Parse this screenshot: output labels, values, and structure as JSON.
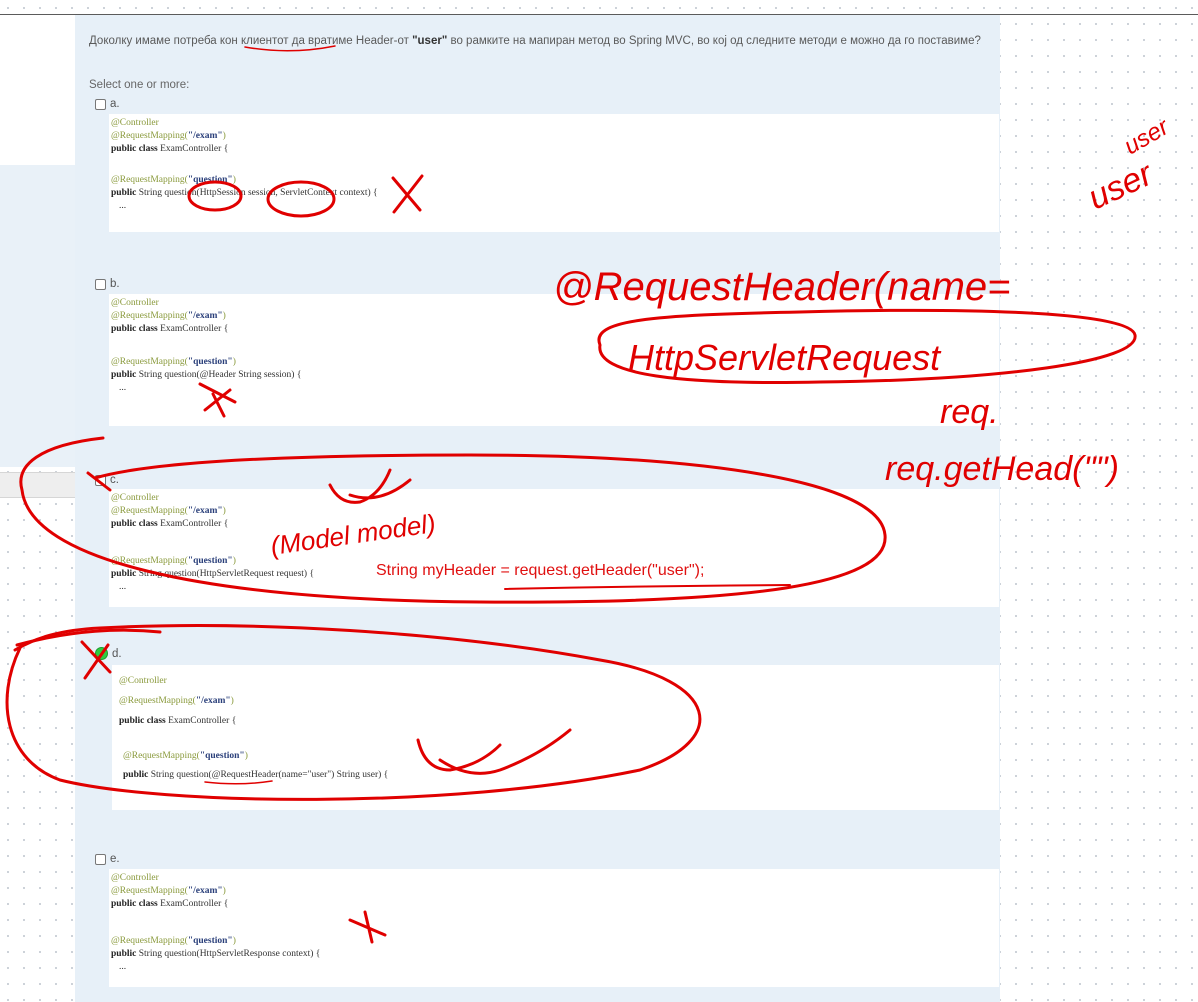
{
  "question": {
    "text_before": "Доколку имаме потреба кон клиентот да вратиме ",
    "header_word": "Header-от",
    "user_quoted": "\"user\"",
    "text_after": " во рамките на мапиран метод во Spring MVC, во кој од следните методи е можно да го поставиме?",
    "select_label": "Select one or more:"
  },
  "options": [
    {
      "letter": "a.",
      "checked": false,
      "lines": {
        "l1": "@Controller",
        "l2a": "@RequestMapping(",
        "l2b": "\"/exam\"",
        "l2c": ")",
        "l3a": "public class",
        "l3b": " ExamController {",
        "l4a": "@RequestMapping(",
        "l4b": "\"question\"",
        "l4c": ")",
        "l5a": "public",
        "l5b": " String question(HttpSession session, ServletContext context) {",
        "l6": "..."
      }
    },
    {
      "letter": "b.",
      "checked": false,
      "lines": {
        "l1": "@Controller",
        "l2a": "@RequestMapping(",
        "l2b": "\"/exam\"",
        "l2c": ")",
        "l3a": "public class",
        "l3b": " ExamController {",
        "l4a": "@RequestMapping(",
        "l4b": "\"question\"",
        "l4c": ")",
        "l5a": "public",
        "l5b": " String question(@Header String session) {",
        "l6": "..."
      }
    },
    {
      "letter": "c.",
      "checked": false,
      "lines": {
        "l1": "@Controller",
        "l2a": "@RequestMapping(",
        "l2b": "\"/exam\"",
        "l2c": ")",
        "l3a": "public class",
        "l3b": " ExamController {",
        "l4a": "@RequestMapping(",
        "l4b": "\"question\"",
        "l4c": ")",
        "l5a": "public",
        "l5b": " String question(HttpServletRequest request) {",
        "l6": "..."
      }
    },
    {
      "letter": "d.",
      "checked": true,
      "lines": {
        "l1": "@Controller",
        "l2a": "@RequestMapping(",
        "l2b": "\"/exam\"",
        "l2c": ")",
        "l3a": "public class",
        "l3b": " ExamController {",
        "l4a": "@RequestMapping(",
        "l4b": "\"question\"",
        "l4c": ")",
        "l5a": "public",
        "l5b": " String question(@RequestHeader(name=\"user\") String user) {",
        "l6": ""
      }
    },
    {
      "letter": "e.",
      "checked": false,
      "lines": {
        "l1": "@Controller",
        "l2a": "@RequestMapping(",
        "l2b": "\"/exam\"",
        "l2c": ")",
        "l3a": "public class",
        "l3b": " ExamController {",
        "l4a": "@RequestMapping(",
        "l4b": "\"question\"",
        "l4c": ")",
        "l5a": "public",
        "l5b": " String question(HttpServletResponse context) {",
        "l6": "..."
      }
    }
  ],
  "annotations": {
    "typed_code": "String myHeader = request.getHeader(\"user\");",
    "handwriting": [
      "@RequestHeader(name=",
      "HttpServletRequest",
      "req.",
      "req.getHead(\"\")",
      "user",
      "user",
      "(Model model)"
    ],
    "colors": {
      "ink": "#e00000",
      "checked": "#2ecc40",
      "panel": "#e7f0f8"
    }
  }
}
